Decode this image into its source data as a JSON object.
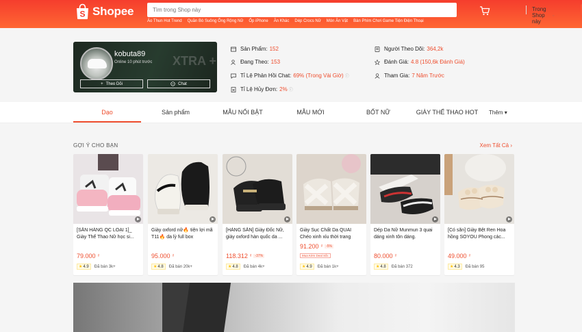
{
  "header": {
    "logo_text": "Shopee",
    "search_placeholder": "Tìm trong Shop này",
    "search_scope": "Trong Shop này",
    "hot_words": [
      "Áo Thun Hot Trend",
      "Quần Bò Suông Ống Rộng Nữ",
      "Ốp iPhone",
      "Ăn Khác",
      "Dép Crocs Nữ",
      "Món Ăn Vặt",
      "Bàn Phím Chơi Game Tiện Điện Thoại"
    ]
  },
  "shop": {
    "name": "kobuta89",
    "online_status": "Online 10 phút trước",
    "bg_text": "XTRA +",
    "follow_label": "Theo Dõi",
    "chat_label": "Chat",
    "stats": {
      "products": {
        "label": "Sản Phẩm:",
        "value": "152"
      },
      "following": {
        "label": "Đang Theo:",
        "value": "153"
      },
      "chat_rate": {
        "label": "Tỉ Lệ Phản Hồi Chat:",
        "value": "69% (Trong Vài Giờ)"
      },
      "cancel_rate": {
        "label": "Tỉ Lệ Hủy Đơn:",
        "value": "2%"
      },
      "followers": {
        "label": "Người Theo Dõi:",
        "value": "364,2k"
      },
      "rating": {
        "label": "Đánh Giá:",
        "value": "4.8 (150,6k Đánh Giá)"
      },
      "joined": {
        "label": "Tham Gia:",
        "value": "7 Năm Trước"
      }
    }
  },
  "nav": {
    "tabs": [
      "Dạo",
      "Sản phẩm",
      "MẪU NỔI BẬT",
      "MẪU MỚI",
      "BỐT NỮ",
      "GIÀY THỂ THAO HOT"
    ],
    "more_label": "Thêm"
  },
  "recommend": {
    "title": "GỢI Ý CHO BẠN",
    "see_all": "Xem Tất Cả",
    "products": [
      {
        "name": "[SẴN HÀNG QC LOẠI 1]_ Giày Thể Thao Nữ học si...",
        "price": "79.000",
        "currency": "₫",
        "discount": "",
        "badge": "",
        "rating": "4.9",
        "sold": "Đã bán 3k+"
      },
      {
        "name": "Giày oxford nữ🔥 tiện lợi mã T11🔥 da lỳ full box",
        "price": "95.000",
        "currency": "₫",
        "discount": "",
        "badge": "",
        "rating": "4.8",
        "sold": "Đã bán 20k+"
      },
      {
        "name": "[HÀNG SẴN] Giày Đốc Nữ, giày oxford hàn quốc da ...",
        "price": "118.312",
        "currency": "₫",
        "discount": "-37%",
        "badge": "",
        "rating": "4.8",
        "sold": "Đã bán 4k+"
      },
      {
        "name": "Giày Sục Chất Da QUAI Chéo xinh xỉu thời trang",
        "price": "91.200",
        "currency": "₫",
        "discount": "-5%",
        "badge": "Mua Kèm Deal Sốc",
        "rating": "4.9",
        "sold": "Đã bán 1k+"
      },
      {
        "name": "Dép Da Nữ Munmun 3 quai dáng xinh tôn dáng.",
        "price": "80.000",
        "currency": "₫",
        "discount": "",
        "badge": "",
        "rating": "4.8",
        "sold": "Đã bán 372"
      },
      {
        "name": "[Có sẵn] Giày Bệt Ren Hoa hồng SOYOU Phong các...",
        "price": "49.000",
        "currency": "₫",
        "discount": "",
        "badge": "",
        "rating": "4.3",
        "sold": "Đã bán 95"
      }
    ]
  },
  "colors": {
    "brand": "#ee4d2d",
    "header": "#f53d2d"
  }
}
